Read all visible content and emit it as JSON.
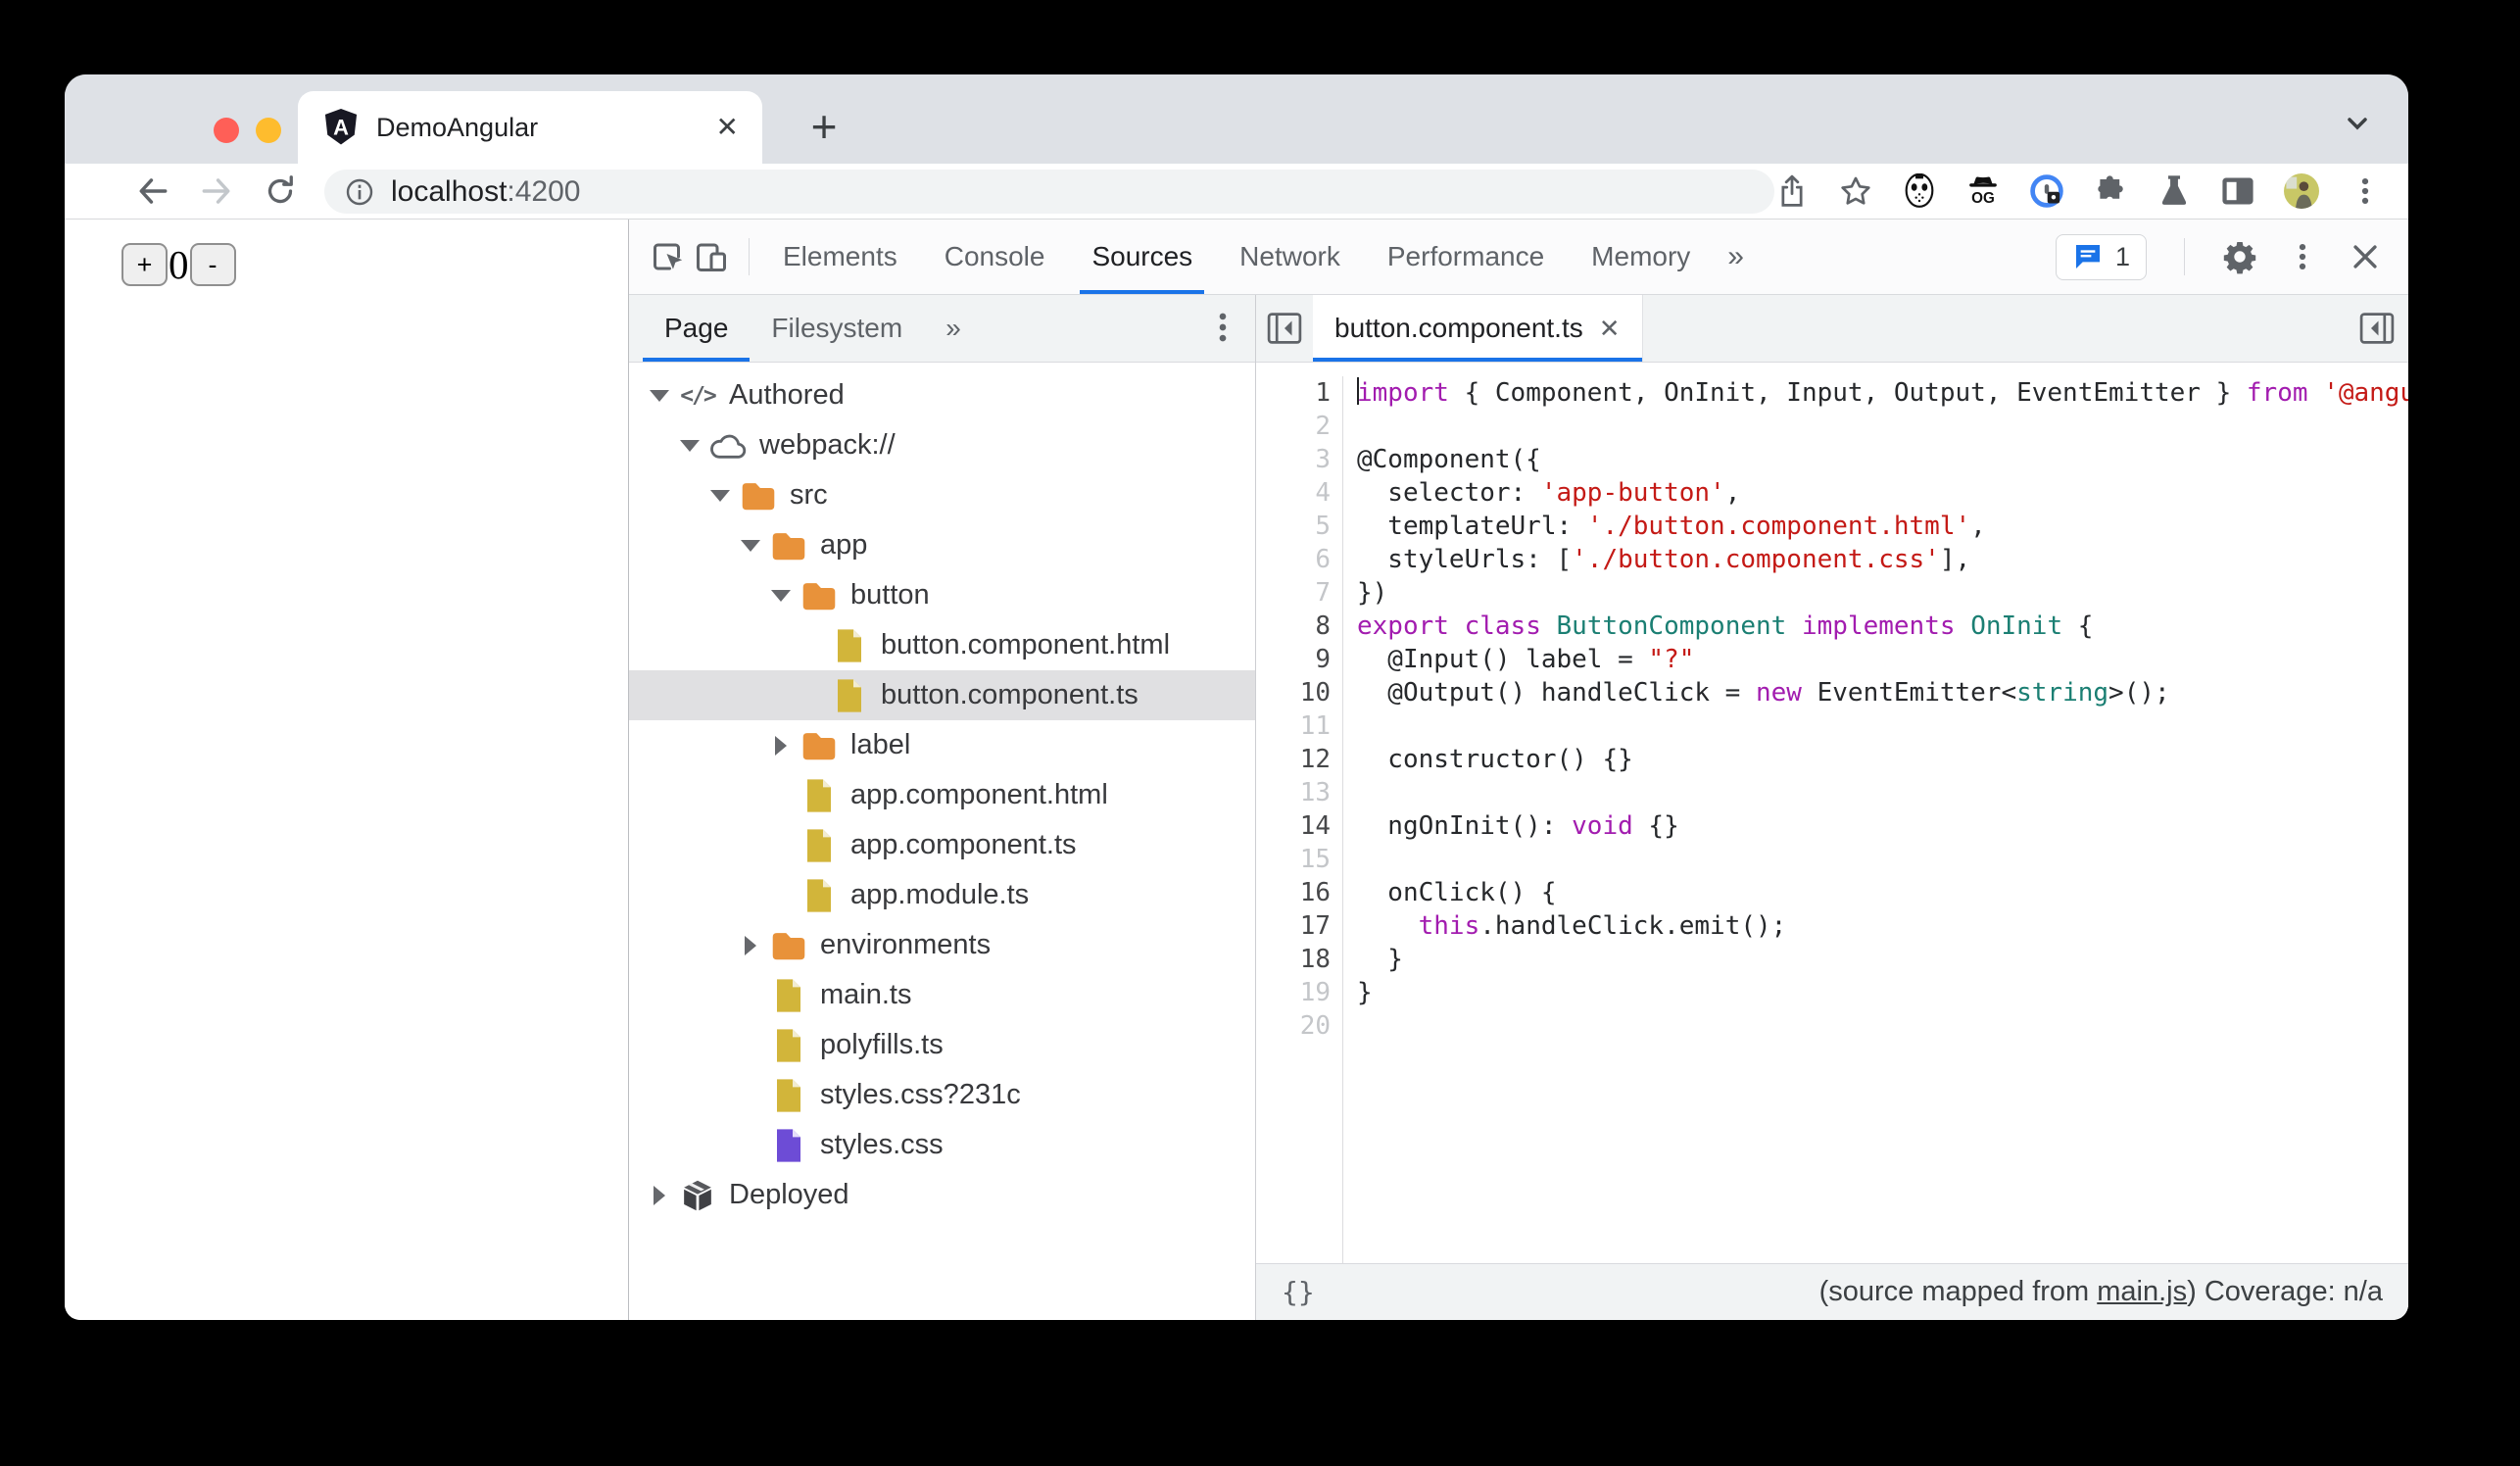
{
  "colors": {
    "accent": "#1a73e8",
    "traffic_red": "#ff5f57",
    "traffic_yellow": "#febc2e",
    "traffic_green": "#28c840",
    "folder": "#e8923a",
    "file_yellow": "#d2b53a",
    "file_purple": "#6d4cd6",
    "syntax_keyword": "#a21caf",
    "syntax_string": "#c41a16",
    "syntax_type": "#1b7f73",
    "selection_row": "#e0e0e2"
  },
  "browser": {
    "tab_title": "DemoAngular",
    "tab_close": "✕",
    "new_tab": "+",
    "url_host": "localhost",
    "url_port": ":4200"
  },
  "page_content": {
    "increment": "+",
    "value": "0",
    "decrement": "-"
  },
  "devtools": {
    "toolbar": {
      "tabs": [
        {
          "label": "Elements",
          "active": false
        },
        {
          "label": "Console",
          "active": false
        },
        {
          "label": "Sources",
          "active": true
        },
        {
          "label": "Network",
          "active": false
        },
        {
          "label": "Performance",
          "active": false
        },
        {
          "label": "Memory",
          "active": false
        }
      ],
      "more_tabs": "»",
      "issues_count": "1"
    },
    "sources_sidebar": {
      "tabs": [
        {
          "label": "Page",
          "active": true
        },
        {
          "label": "Filesystem",
          "active": false
        }
      ],
      "more_tabs": "»"
    },
    "file_tree": [
      {
        "depth": 0,
        "icon": "code",
        "state": "open",
        "label": "Authored",
        "selected": false
      },
      {
        "depth": 1,
        "icon": "cloud",
        "state": "open",
        "label": "webpack://",
        "selected": false
      },
      {
        "depth": 2,
        "icon": "folder",
        "state": "open",
        "label": "src",
        "selected": false
      },
      {
        "depth": 3,
        "icon": "folder",
        "state": "open",
        "label": "app",
        "selected": false
      },
      {
        "depth": 4,
        "icon": "folder",
        "state": "open",
        "label": "button",
        "selected": false
      },
      {
        "depth": 5,
        "icon": "file-yellow",
        "state": "leaf",
        "label": "button.component.html",
        "selected": false
      },
      {
        "depth": 5,
        "icon": "file-yellow",
        "state": "leaf",
        "label": "button.component.ts",
        "selected": true
      },
      {
        "depth": 4,
        "icon": "folder",
        "state": "closed",
        "label": "label",
        "selected": false
      },
      {
        "depth": 4,
        "icon": "file-yellow",
        "state": "leaf",
        "label": "app.component.html",
        "selected": false
      },
      {
        "depth": 4,
        "icon": "file-yellow",
        "state": "leaf",
        "label": "app.component.ts",
        "selected": false
      },
      {
        "depth": 4,
        "icon": "file-yellow",
        "state": "leaf",
        "label": "app.module.ts",
        "selected": false
      },
      {
        "depth": 3,
        "icon": "folder",
        "state": "closed",
        "label": "environments",
        "selected": false
      },
      {
        "depth": 3,
        "icon": "file-yellow",
        "state": "leaf",
        "label": "main.ts",
        "selected": false
      },
      {
        "depth": 3,
        "icon": "file-yellow",
        "state": "leaf",
        "label": "polyfills.ts",
        "selected": false
      },
      {
        "depth": 3,
        "icon": "file-yellow",
        "state": "leaf",
        "label": "styles.css?231c",
        "selected": false
      },
      {
        "depth": 3,
        "icon": "file-purple",
        "state": "leaf",
        "label": "styles.css",
        "selected": false
      },
      {
        "depth": 0,
        "icon": "cube",
        "state": "closed",
        "label": "Deployed",
        "selected": false
      }
    ],
    "editor": {
      "tab_label": "button.component.ts",
      "tab_close": "✕",
      "lines": [
        {
          "n": 1,
          "mapped": true,
          "caret": true,
          "tokens": [
            [
              "k",
              "import"
            ],
            [
              "p",
              " { Component, OnInit, Input, Output, EventEmitter } "
            ],
            [
              "k",
              "from"
            ],
            [
              "p",
              " "
            ],
            [
              "s",
              "'@angular/core';"
            ]
          ]
        },
        {
          "n": 2,
          "mapped": false,
          "tokens": []
        },
        {
          "n": 3,
          "mapped": false,
          "tokens": [
            [
              "p",
              "@Component({"
            ]
          ]
        },
        {
          "n": 4,
          "mapped": false,
          "tokens": [
            [
              "p",
              "  selector: "
            ],
            [
              "s",
              "'app-button'"
            ],
            [
              "p",
              ","
            ]
          ]
        },
        {
          "n": 5,
          "mapped": false,
          "tokens": [
            [
              "p",
              "  templateUrl: "
            ],
            [
              "s",
              "'./button.component.html'"
            ],
            [
              "p",
              ","
            ]
          ]
        },
        {
          "n": 6,
          "mapped": false,
          "tokens": [
            [
              "p",
              "  styleUrls: ["
            ],
            [
              "s",
              "'./button.component.css'"
            ],
            [
              "p",
              "],"
            ]
          ]
        },
        {
          "n": 7,
          "mapped": false,
          "tokens": [
            [
              "p",
              "})"
            ]
          ]
        },
        {
          "n": 8,
          "mapped": true,
          "tokens": [
            [
              "k",
              "export"
            ],
            [
              "p",
              " "
            ],
            [
              "k",
              "class"
            ],
            [
              "p",
              " "
            ],
            [
              "t",
              "ButtonComponent"
            ],
            [
              "p",
              " "
            ],
            [
              "k",
              "implements"
            ],
            [
              "p",
              " "
            ],
            [
              "t",
              "OnInit"
            ],
            [
              "p",
              " {"
            ]
          ]
        },
        {
          "n": 9,
          "mapped": true,
          "tokens": [
            [
              "p",
              "  @Input() label = "
            ],
            [
              "s",
              "\"?\""
            ]
          ]
        },
        {
          "n": 10,
          "mapped": true,
          "tokens": [
            [
              "p",
              "  @Output() handleClick = "
            ],
            [
              "k",
              "new"
            ],
            [
              "p",
              " EventEmitter<"
            ],
            [
              "t",
              "string"
            ],
            [
              "p",
              ">();"
            ]
          ]
        },
        {
          "n": 11,
          "mapped": false,
          "tokens": []
        },
        {
          "n": 12,
          "mapped": true,
          "tokens": [
            [
              "p",
              "  constructor() {}"
            ]
          ]
        },
        {
          "n": 13,
          "mapped": false,
          "tokens": []
        },
        {
          "n": 14,
          "mapped": true,
          "tokens": [
            [
              "p",
              "  ngOnInit(): "
            ],
            [
              "k",
              "void"
            ],
            [
              "p",
              " {}"
            ]
          ]
        },
        {
          "n": 15,
          "mapped": false,
          "tokens": []
        },
        {
          "n": 16,
          "mapped": true,
          "tokens": [
            [
              "p",
              "  onClick() {"
            ]
          ]
        },
        {
          "n": 17,
          "mapped": true,
          "tokens": [
            [
              "p",
              "    "
            ],
            [
              "k",
              "this"
            ],
            [
              "p",
              ".handleClick.emit();"
            ]
          ]
        },
        {
          "n": 18,
          "mapped": true,
          "tokens": [
            [
              "p",
              "  }"
            ]
          ]
        },
        {
          "n": 19,
          "mapped": false,
          "tokens": [
            [
              "p",
              "}"
            ]
          ]
        },
        {
          "n": 20,
          "mapped": false,
          "tokens": []
        }
      ]
    },
    "statusbar": {
      "pretty_print": "{}",
      "mapped_prefix": "(source mapped from ",
      "mapped_link": "main.js",
      "mapped_suffix": ") Coverage: n/a"
    }
  }
}
